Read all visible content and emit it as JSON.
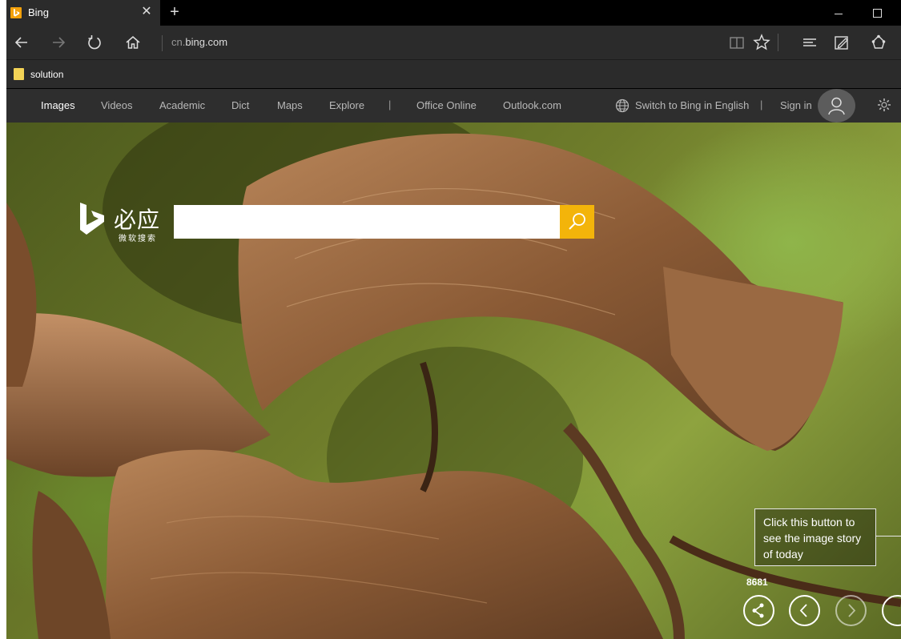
{
  "tab": {
    "title": "Bing",
    "close": "✕",
    "new_tab": "+"
  },
  "address": {
    "prefix": "cn.",
    "domain": "bing.com"
  },
  "favorites": [
    {
      "label": "solution"
    }
  ],
  "header": {
    "nav": [
      "Images",
      "Videos",
      "Academic",
      "Dict",
      "Maps",
      "Explore"
    ],
    "divider": "|",
    "nav2": [
      "Office Online",
      "Outlook.com"
    ],
    "switch_lang": "Switch to Bing in English",
    "sign_in": "Sign in"
  },
  "logo": {
    "name": "必应",
    "subtitle": "微软搜索"
  },
  "search": {
    "value": "",
    "placeholder": ""
  },
  "tooltip": {
    "text": "Click this button to see the image story of today"
  },
  "share_count": "8681",
  "colors": {
    "accent": "#f3b40a",
    "chrome": "#2b2b2b",
    "header": "#2e2e2e"
  },
  "icons": [
    "back-icon",
    "forward-icon",
    "refresh-icon",
    "home-icon",
    "reading-view-icon",
    "favorite-star-icon",
    "hub-icon",
    "web-note-icon",
    "share-icon",
    "globe-icon",
    "user-icon",
    "gear-icon",
    "search-icon",
    "chevron-left-icon",
    "chevron-right-icon"
  ]
}
